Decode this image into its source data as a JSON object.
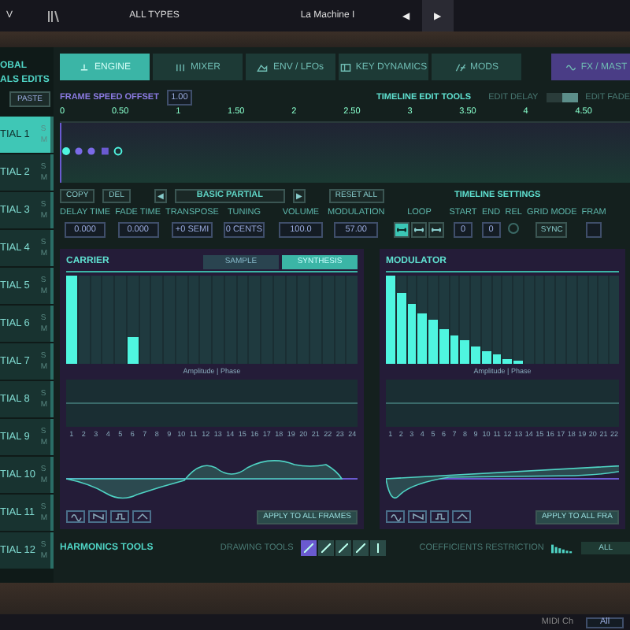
{
  "top_bar": {
    "menu": "V",
    "category": "ALL TYPES",
    "preset": "La Machine I",
    "prev": "◀",
    "next": "▶"
  },
  "sidebar": {
    "title_lines": [
      "OBAL",
      "ALS EDITS"
    ],
    "paste": "PASTE",
    "partials": [
      {
        "label": "TIAL 1",
        "solo": "S",
        "mute": "M",
        "selected": true
      },
      {
        "label": "TIAL 2",
        "solo": "S",
        "mute": "M",
        "selected": false
      },
      {
        "label": "TIAL 3",
        "solo": "S",
        "mute": "M",
        "selected": false
      },
      {
        "label": "TIAL 4",
        "solo": "S",
        "mute": "M",
        "selected": false
      },
      {
        "label": "TIAL 5",
        "solo": "S",
        "mute": "M",
        "selected": false
      },
      {
        "label": "TIAL 6",
        "solo": "S",
        "mute": "M",
        "selected": false
      },
      {
        "label": "TIAL 7",
        "solo": "S",
        "mute": "M",
        "selected": false
      },
      {
        "label": "TIAL 8",
        "solo": "S",
        "mute": "M",
        "selected": false
      },
      {
        "label": "TIAL 9",
        "solo": "S",
        "mute": "M",
        "selected": false
      },
      {
        "label": "TIAL 10",
        "solo": "S",
        "mute": "M",
        "selected": false
      },
      {
        "label": "TIAL 11",
        "solo": "S",
        "mute": "M",
        "selected": false
      },
      {
        "label": "TIAL 12",
        "solo": "S",
        "mute": "M",
        "selected": false
      }
    ]
  },
  "tabs": [
    {
      "label": "ENGINE",
      "selected": true,
      "kind": "main"
    },
    {
      "label": "MIXER",
      "selected": false,
      "kind": "main"
    },
    {
      "label": "ENV / LFOs",
      "selected": false,
      "kind": "main"
    },
    {
      "label": "KEY DYNAMICS",
      "selected": false,
      "kind": "main"
    },
    {
      "label": "MODS",
      "selected": false,
      "kind": "main"
    },
    {
      "label": "FX / MAST",
      "selected": false,
      "kind": "fx"
    }
  ],
  "timeline": {
    "speed_label": "FRAME SPEED OFFSET",
    "speed_value": "1.00",
    "tools_label": "TIMELINE EDIT TOOLS",
    "edit_delay": "EDIT DELAY",
    "edit_fade": "EDIT FADE",
    "fade_on": true,
    "ruler": [
      "0",
      "0.50",
      "1",
      "1.50",
      "2",
      "2.50",
      "3",
      "3.50",
      "4",
      "4.50"
    ]
  },
  "partial_bar": {
    "copy": "COPY",
    "del": "DEL",
    "prev": "◀",
    "name": "BASIC PARTIAL",
    "next": "▶",
    "reset": "RESET ALL",
    "settings_title": "TIMELINE SETTINGS"
  },
  "params": [
    {
      "label": "DELAY TIME",
      "value": "0.000"
    },
    {
      "label": "FADE TIME",
      "value": "0.000"
    },
    {
      "label": "TRANSPOSE",
      "value": "+0 SEMI"
    },
    {
      "label": "TUNING",
      "value": "0 CENTS"
    }
  ],
  "mix_params": [
    {
      "label": "VOLUME",
      "value": "100.0"
    },
    {
      "label": "MODULATION",
      "value": "57.00"
    }
  ],
  "timeline_settings": {
    "loop_label": "LOOP",
    "loop_modes": [
      {
        "selected": true
      },
      {
        "selected": false
      },
      {
        "selected": false
      }
    ],
    "start_label": "START",
    "start": "0",
    "end_label": "END",
    "end": "0",
    "rel_label": "REL",
    "grid_label": "GRID MODE",
    "grid": "SYNC",
    "frame_label": "FRAM"
  },
  "panels": [
    {
      "title": "CARRIER",
      "modes": [
        {
          "label": "SAMPLE",
          "selected": false
        },
        {
          "label": "SYNTHESIS",
          "selected": true
        }
      ],
      "axis_label": "Amplitude | Phase",
      "harmonics": [
        "1",
        "2",
        "3",
        "4",
        "5",
        "6",
        "7",
        "8",
        "9",
        "10",
        "11",
        "12",
        "13",
        "14",
        "15",
        "16",
        "17",
        "18",
        "19",
        "20",
        "21",
        "22",
        "23",
        "24"
      ],
      "apply": "APPLY TO ALL FRAMES",
      "kind": "carrier"
    },
    {
      "title": "MODULATOR",
      "axis_label": "Amplitude | Phase",
      "harmonics": [
        "1",
        "2",
        "3",
        "4",
        "5",
        "6",
        "7",
        "8",
        "9",
        "10",
        "11",
        "12",
        "13",
        "14",
        "15",
        "16",
        "17",
        "18",
        "19",
        "20",
        "21",
        "22"
      ],
      "apply": "APPLY TO ALL FRA",
      "kind": "modulator"
    }
  ],
  "harmonics_tools": {
    "title": "HARMONICS TOOLS",
    "drawing_label": "DRAWING TOOLS",
    "tools": [
      {
        "selected": true
      },
      {
        "selected": false
      },
      {
        "selected": false
      },
      {
        "selected": false
      },
      {
        "selected": false
      }
    ],
    "coeff_label": "COEFFICIENTS RESTRICTION",
    "coeff_value": "ALL"
  },
  "bottom_bar": {
    "midi_label": "MIDI Ch",
    "midi_value": "All"
  }
}
